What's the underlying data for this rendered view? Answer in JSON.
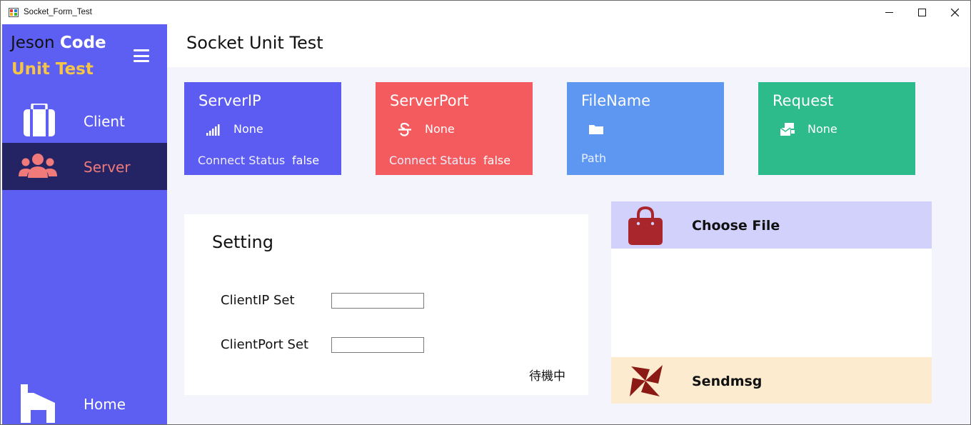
{
  "window": {
    "title": "Socket_Form_Test"
  },
  "sidebar": {
    "brand_prefix": "Jeson",
    "brand_bold": "Code",
    "brand_sub": "Unit Test",
    "items": [
      {
        "label": "Client",
        "icon": "briefcase-icon"
      },
      {
        "label": "Server",
        "icon": "users-icon",
        "selected": true
      },
      {
        "label": "Home",
        "icon": "home-icon"
      }
    ]
  },
  "header": {
    "title": "Socket Unit Test"
  },
  "cards": {
    "server_ip": {
      "title": "ServerIP",
      "value": "None",
      "status_label": "Connect Status",
      "status_value": "false",
      "icon": "signal-icon"
    },
    "server_port": {
      "title": "ServerPort",
      "value": "None",
      "status_label": "Connect Status",
      "status_value": "false",
      "icon": "strikethrough-icon"
    },
    "file_name": {
      "title": "FileName",
      "path_label": "Path",
      "icon": "folder-icon"
    },
    "request": {
      "title": "Request",
      "value": "None",
      "icon": "mail-bulk-icon"
    }
  },
  "setting": {
    "title": "Setting",
    "client_ip_label": "ClientIP Set",
    "client_ip_value": "",
    "client_port_label": "ClientPort Set",
    "client_port_value": "",
    "status": "待機中"
  },
  "actions": {
    "choose_file": "Choose File",
    "sendmsg": "Sendmsg"
  },
  "colors": {
    "sidebar": "#5d5ff3",
    "sidebar_selected": "#242465",
    "card_ip": "#5c5bf2",
    "card_port": "#f45b5e",
    "card_file": "#5e97f1",
    "card_request": "#2dbb8b",
    "choose_file_bg": "#d1d1fb",
    "sendmsg_bg": "#fdebd0"
  }
}
